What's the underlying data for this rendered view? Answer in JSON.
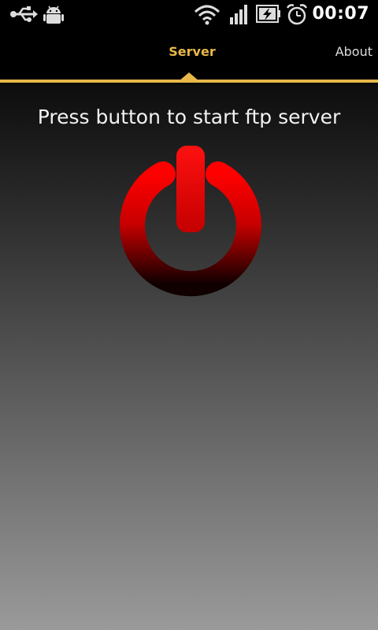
{
  "status_bar": {
    "time": "00:07",
    "icons": [
      "usb-icon",
      "android-debug-icon",
      "wifi-icon",
      "signal-icon",
      "battery-charging-icon",
      "alarm-icon"
    ]
  },
  "tabs": [
    {
      "label": "Server",
      "selected": true
    },
    {
      "label": "About",
      "selected": false
    }
  ],
  "main": {
    "prompt": "Press button to start ftp server",
    "power_button_icon": "power-icon"
  },
  "colors": {
    "accent": "#e8b84a",
    "power_red": "#e60000"
  }
}
